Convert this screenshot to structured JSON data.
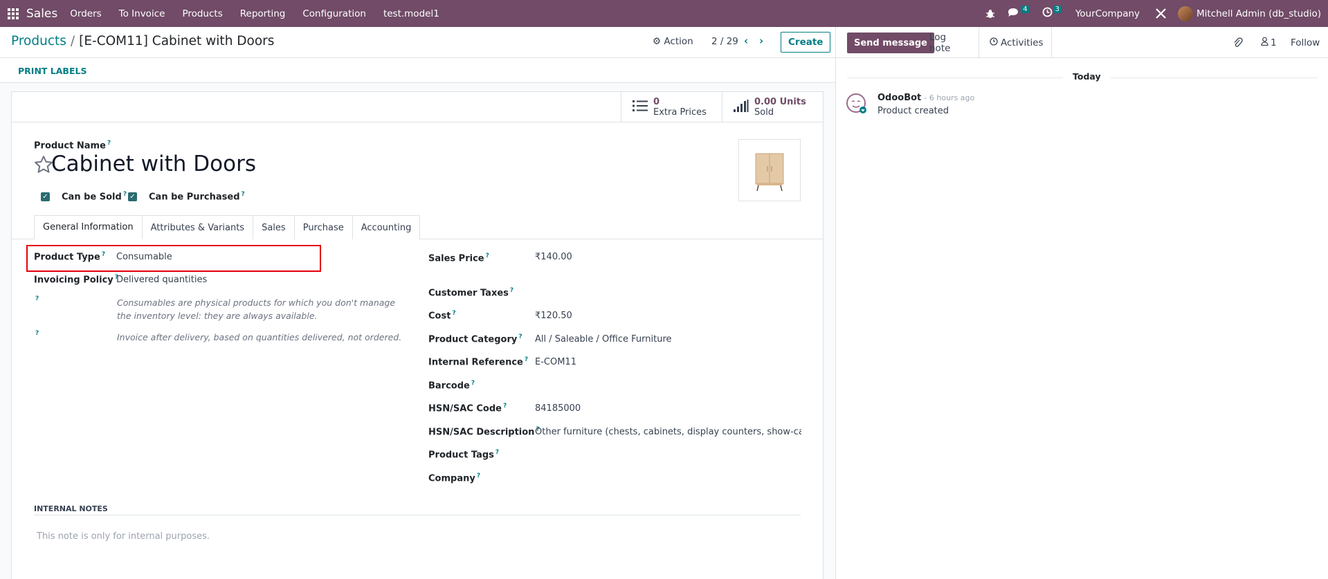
{
  "navbar": {
    "app_name": "Sales",
    "menu": [
      "Orders",
      "To Invoice",
      "Products",
      "Reporting",
      "Configuration",
      "test.model1"
    ],
    "messages_count": "4",
    "activities_count": "3",
    "company": "YourCompany",
    "user": "Mitchell Admin (db_studio)"
  },
  "control": {
    "breadcrumb_parent": "Products",
    "breadcrumb_sep": "/",
    "breadcrumb_current": "[E-COM11] Cabinet with Doors",
    "action_label": "Action",
    "pager": "2 / 29",
    "create_label": "Create",
    "print_labels": "PRINT LABELS"
  },
  "stat_buttons": {
    "extra_prices_count": "0",
    "extra_prices_label": "Extra Prices",
    "sold_value": "0.00 Units",
    "sold_label": "Sold"
  },
  "form": {
    "product_name_label": "Product Name",
    "product_name": "Cabinet with Doors",
    "can_be_sold_label": "Can be Sold",
    "can_be_purchased_label": "Can be Purchased",
    "tabs": [
      "General Information",
      "Attributes & Variants",
      "Sales",
      "Purchase",
      "Accounting"
    ],
    "product_type_label": "Product Type",
    "product_type": "Consumable",
    "invoicing_policy_label": "Invoicing Policy",
    "invoicing_policy": "Delivered quantities",
    "help_consumable": "Consumables are physical products for which you don't manage the inventory level: they are always available.",
    "help_invoice": "Invoice after delivery, based on quantities delivered, not ordered.",
    "sales_price_label": "Sales Price",
    "sales_price": "₹140.00",
    "customer_taxes_label": "Customer Taxes",
    "cost_label": "Cost",
    "cost": "₹120.50",
    "category_label": "Product Category",
    "category": "All / Saleable / Office Furniture",
    "internal_ref_label": "Internal Reference",
    "internal_ref": "E-COM11",
    "barcode_label": "Barcode",
    "hsn_code_label": "HSN/SAC Code",
    "hsn_code": "84185000",
    "hsn_desc_label": "HSN/SAC Description",
    "hsn_desc": "Other furniture (chests, cabinets, display counters, show-cases an",
    "tags_label": "Product Tags",
    "company_label": "Company",
    "internal_notes_label": "INTERNAL NOTES",
    "notes_placeholder": "This note is only for internal purposes."
  },
  "chatter": {
    "send_message": "Send message",
    "log_note": "Log note",
    "activities": "Activities",
    "followers_count": "1",
    "follow": "Follow",
    "date_separator": "Today",
    "author": "OdooBot",
    "time": "- 6 hours ago",
    "message": "Product created"
  },
  "colors": {
    "brand": "#714B67",
    "accent": "#017e84",
    "highlight": "#e3000b"
  }
}
